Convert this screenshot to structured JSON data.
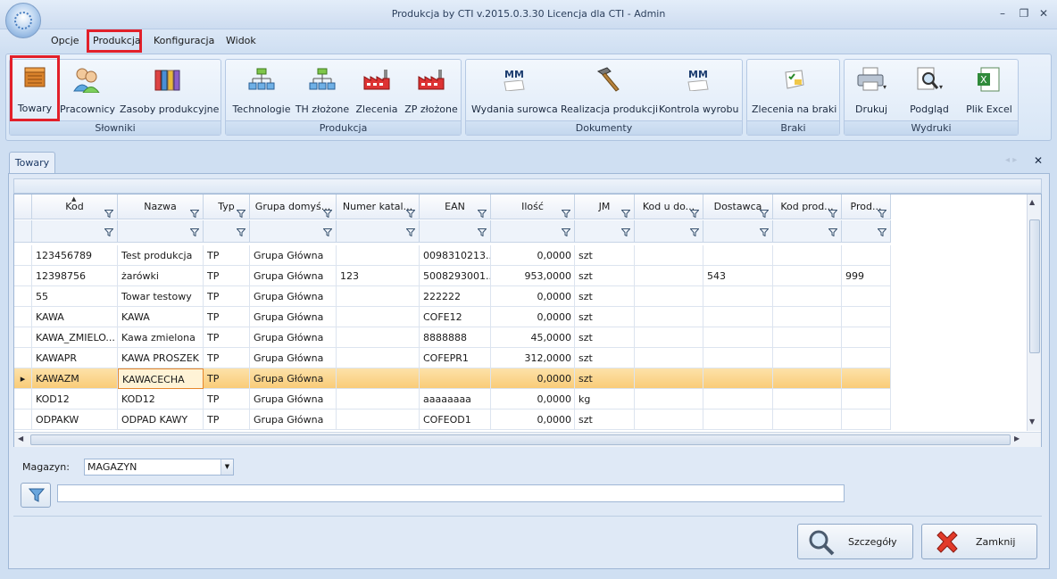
{
  "window": {
    "title": "Produkcja by CTI v.2015.0.3.30 Licencja dla CTI - Admin",
    "minimize": "–",
    "restore": "❐",
    "close": "✕"
  },
  "menu": [
    "Opcje",
    "Produkcja",
    "Konfiguracja",
    "Widok"
  ],
  "ribbon": {
    "groups": [
      {
        "label": "Słowniki",
        "buttons": [
          "Towary",
          "Pracownicy",
          "Zasoby produkcyjne"
        ]
      },
      {
        "label": "Produkcja",
        "buttons": [
          "Technologie",
          "TH złożone",
          "Zlecenia",
          "ZP złożone"
        ]
      },
      {
        "label": "Dokumenty",
        "buttons": [
          "Wydania surowca",
          "Realizacja produkcji",
          "Kontrola wyrobu"
        ]
      },
      {
        "label": "Braki",
        "buttons": [
          "Zlecenia na braki"
        ]
      },
      {
        "label": "Wydruki",
        "buttons": [
          "Drukuj",
          "Podgląd",
          "Plik Excel"
        ]
      }
    ],
    "mm_label": "MM"
  },
  "tab": {
    "label": "Towary"
  },
  "grid": {
    "columns": [
      "Kod",
      "Nazwa",
      "Typ",
      "Grupa domyś...",
      "Numer katal...",
      "EAN",
      "Ilość",
      "JM",
      "Kod u do...",
      "Dostawca",
      "Kod prod...",
      "Prod..."
    ],
    "rows": [
      [
        "123456789",
        "Test produkcja",
        "TP",
        "Grupa Główna",
        "",
        "0098310213...",
        "0,0000",
        "szt",
        "",
        "",
        "",
        ""
      ],
      [
        "12398756",
        "żarówki",
        "TP",
        "Grupa Główna",
        "123",
        "5008293001...",
        "953,0000",
        "szt",
        "",
        "543",
        "",
        "999"
      ],
      [
        "55",
        "Towar testowy",
        "TP",
        "Grupa Główna",
        "",
        "222222",
        "0,0000",
        "szt",
        "",
        "",
        "",
        ""
      ],
      [
        "KAWA",
        "KAWA",
        "TP",
        "Grupa Główna",
        "",
        "COFE12",
        "0,0000",
        "szt",
        "",
        "",
        "",
        ""
      ],
      [
        "KAWA_ZMIELO...",
        "Kawa zmielona",
        "TP",
        "Grupa Główna",
        "",
        "8888888",
        "45,0000",
        "szt",
        "",
        "",
        "",
        ""
      ],
      [
        "KAWAPR",
        "KAWA PROSZEK",
        "TP",
        "Grupa Główna",
        "",
        "COFEPR1",
        "312,0000",
        "szt",
        "",
        "",
        "",
        ""
      ],
      [
        "KAWAZM",
        "KAWACECHA",
        "TP",
        "Grupa Główna",
        "",
        "",
        "0,0000",
        "szt",
        "",
        "",
        "",
        ""
      ],
      [
        "KOD12",
        "KOD12",
        "TP",
        "Grupa Główna",
        "",
        "aaaaaaaa",
        "0,0000",
        "kg",
        "",
        "",
        "",
        ""
      ],
      [
        "ODPAKW",
        "ODPAD KAWY",
        "TP",
        "Grupa Główna",
        "",
        "COFEOD1",
        "0,0000",
        "szt",
        "",
        "",
        "",
        ""
      ]
    ],
    "selected_row": 6,
    "row_indicator": "▸"
  },
  "magazyn": {
    "label": "Magazyn:",
    "value": "MAGAZYN"
  },
  "buttons": {
    "details": "Szczegóły",
    "close": "Zamknij"
  },
  "colors": {
    "accent": "#e2202a",
    "selection": "#f9cc78"
  }
}
